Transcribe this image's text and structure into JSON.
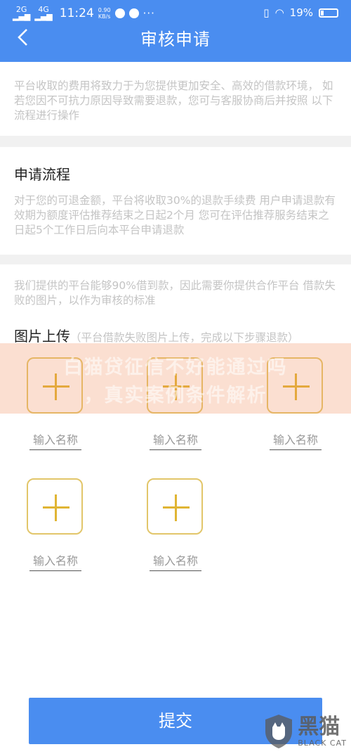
{
  "status_bar": {
    "net1": "2G",
    "net2": "4G",
    "time": "11:24",
    "speed_value": "0.90",
    "speed_unit": "KB/s",
    "more": "···",
    "battery": "19%"
  },
  "header": {
    "title": "审核申请"
  },
  "intro_text": "平台收取的费用将致力于为您提供更加安全、高效的借款环境， 如若您因不可抗力原因导致需要退款，您可与客服协商后并按照 以下流程进行操作",
  "process": {
    "title": "申请流程",
    "text": "对于您的可退金额，平台将收取30%的退款手续费 用户申请退款有效期为额度评估推荐结束之日起2个月 您可在评估推荐服务结束之日起5个工作日后向本平台申请退款"
  },
  "upload": {
    "intro": "我们提供的平台能够90%借到款，因此需要你提供合作平台 借款失败的图片，以作为审核的标准",
    "title": "图片上传",
    "note": "（平台借款失败图片上传，完成以下步骤退款）",
    "slots": [
      {
        "placeholder": "输入名称"
      },
      {
        "placeholder": "输入名称"
      },
      {
        "placeholder": "输入名称"
      },
      {
        "placeholder": "输入名称"
      },
      {
        "placeholder": "输入名称"
      }
    ]
  },
  "banner": {
    "line1": "白猫贷征信不好能通过吗",
    "line2": "，真实案例条件解析"
  },
  "submit_label": "提交",
  "brand": {
    "name_cn": "黑猫",
    "name_en": "BLACK CAT"
  },
  "colors": {
    "primary": "#4a8df0",
    "tile_border": "#e2c66a",
    "plus": "#e0b534"
  }
}
